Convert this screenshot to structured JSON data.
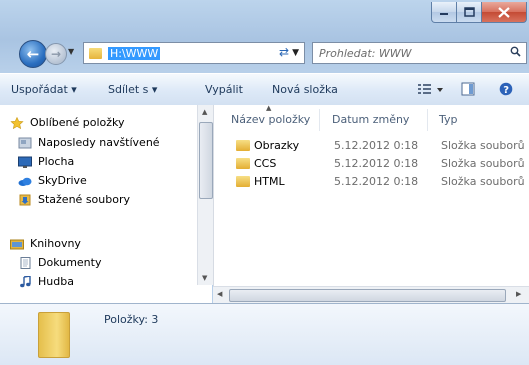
{
  "address": {
    "path": "H:\\WWW"
  },
  "search": {
    "placeholder": "Prohledat: WWW"
  },
  "toolbar": {
    "organize": "Uspořádat",
    "share": "Sdílet s",
    "burn": "Vypálit",
    "new_folder": "Nová složka"
  },
  "sidebar": {
    "favorites": "Oblíbené položky",
    "recent": "Naposledy navštívené",
    "desktop": "Plocha",
    "skydrive": "SkyDrive",
    "downloads": "Stažené soubory",
    "libraries": "Knihovny",
    "documents": "Dokumenty",
    "music": "Hudba"
  },
  "columns": {
    "name": "Název položky",
    "date": "Datum změny",
    "type": "Typ"
  },
  "files": [
    {
      "name": "Obrazky",
      "date": "5.12.2012 0:18",
      "type": "Složka souborů"
    },
    {
      "name": "CCS",
      "date": "5.12.2012 0:18",
      "type": "Složka souborů"
    },
    {
      "name": "HTML",
      "date": "5.12.2012 0:18",
      "type": "Složka souborů"
    }
  ],
  "details": {
    "count": "Položky: 3"
  }
}
